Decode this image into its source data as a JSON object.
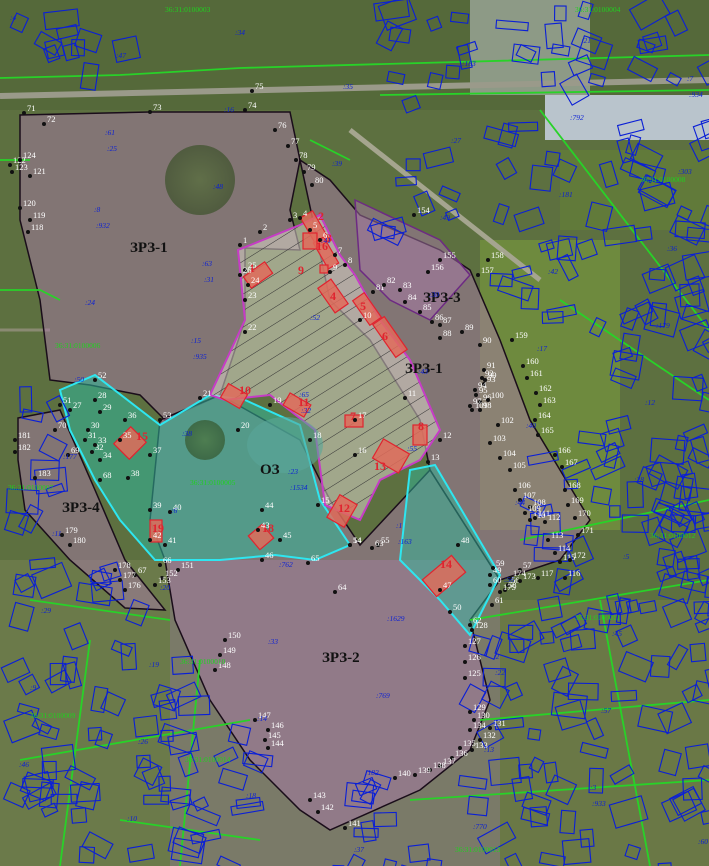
{
  "map": {
    "zones": [
      {
        "id": "zrz1_north",
        "label": "ЗРЗ-1"
      },
      {
        "id": "zrz1_east",
        "label": "ЗРЗ-1"
      },
      {
        "id": "zrz2",
        "label": "ЗРЗ-2"
      },
      {
        "id": "zrz3",
        "label": "ЗРЗ-3"
      },
      {
        "id": "zrz4",
        "label": "ЗРЗ-4"
      },
      {
        "id": "oz",
        "label": "ОЗ"
      }
    ],
    "objects": [
      "1",
      "2",
      "3",
      "4",
      "5",
      "6",
      "7",
      "8",
      "9",
      "10",
      "11",
      "12",
      "13",
      "14",
      "15",
      "16",
      "18",
      "19"
    ],
    "boundary_points": [
      "1",
      "2",
      "3",
      "4",
      "5",
      "6",
      "7",
      "8",
      "9",
      "10",
      "11",
      "12",
      "13",
      "14",
      "15",
      "16",
      "17",
      "18",
      "19",
      "20",
      "21",
      "22",
      "23",
      "24",
      "25",
      "26",
      "27",
      "28",
      "29",
      "30",
      "31",
      "32",
      "33",
      "34",
      "35",
      "36",
      "37",
      "38",
      "39",
      "40",
      "41",
      "42",
      "43",
      "44",
      "45",
      "46",
      "47",
      "48",
      "49",
      "50",
      "51",
      "52",
      "53",
      "54",
      "55",
      "56",
      "57",
      "58",
      "59",
      "60",
      "61",
      "62",
      "63",
      "64",
      "65",
      "66",
      "67",
      "68",
      "69",
      "70",
      "71",
      "72",
      "73",
      "74",
      "75",
      "76",
      "77",
      "78",
      "79",
      "80",
      "81",
      "82",
      "83",
      "84",
      "85",
      "86",
      "87",
      "88",
      "89",
      "90",
      "91",
      "92",
      "93",
      "94",
      "95",
      "96",
      "97",
      "98",
      "99",
      "100",
      "101",
      "102",
      "103",
      "104",
      "105",
      "106",
      "107",
      "108",
      "109",
      "110",
      "111",
      "112",
      "113",
      "114",
      "115",
      "116",
      "117",
      "118",
      "119",
      "120",
      "121",
      "122",
      "123",
      "124",
      "125",
      "126",
      "127",
      "128",
      "129",
      "130",
      "131",
      "132",
      "133",
      "134",
      "135",
      "136",
      "137",
      "138",
      "139",
      "140",
      "141",
      "142",
      "143",
      "144",
      "145",
      "146",
      "147",
      "148",
      "149",
      "150",
      "151",
      "152",
      "153",
      "154",
      "155",
      "156",
      "157",
      "158",
      "159",
      "160",
      "161",
      "162",
      "163",
      "164",
      "165",
      "166",
      "167",
      "168",
      "169",
      "170",
      "171",
      "172",
      "173",
      "174",
      "175",
      "176",
      "177",
      "178",
      "179",
      "180",
      "181",
      "182",
      "183"
    ],
    "parcel_labels": [
      ":4",
      ":25",
      ":31",
      ":32",
      ":163",
      ":22",
      ":933",
      ":934",
      ":932",
      ":935",
      ":1534",
      ":1629",
      ":13",
      ":21",
      ":303",
      ":24",
      ":38",
      ":762",
      ":769",
      ":770",
      ":792",
      ":36",
      ":50",
      ":6",
      ":33",
      ":182",
      ":183",
      ":181",
      ":179",
      ":177",
      ":20",
      ":14",
      ":37",
      ":27",
      ":42",
      ":12",
      ":11",
      ":19",
      ":18",
      ":35",
      ":49",
      ":17",
      ":28",
      ":29",
      ":26",
      ":34",
      ":39",
      ":30",
      ":40",
      ":5",
      ":9",
      ":10",
      ":16",
      ":41",
      ":43",
      ":44",
      ":45",
      ":46",
      ":47",
      ":48",
      ":52",
      ":55",
      ":56",
      ":57",
      ":60",
      ":61",
      ":63",
      ":65",
      ":1",
      ":2",
      ":3",
      ":7",
      ":8",
      ":15",
      ":23"
    ],
    "cadastral_labels": [
      "36:31:0100003",
      "36:31:0100004",
      "36:31:0100005",
      "36:31:0100006",
      "36:31:0100007",
      "36:31:0100008",
      "36:31:0100009",
      "36:31:0100010",
      "36:31:0100011",
      "36:31:0100012",
      "36:31:0100013",
      "36:31:0100014"
    ],
    "colors": {
      "zrz1_fill": "#a87aa8",
      "zrz1_border": "#1a0d1a",
      "zrz3_border": "#6d2a83",
      "oz_fill": "#2fb89a",
      "oz_border": "#2ee6f0",
      "object_fill": "#e06b5a",
      "object_border": "#e0242f",
      "hatch_border": "#c63cc6",
      "parcel_line": "#0a1fd6",
      "cadastral_line": "#28d228"
    }
  }
}
